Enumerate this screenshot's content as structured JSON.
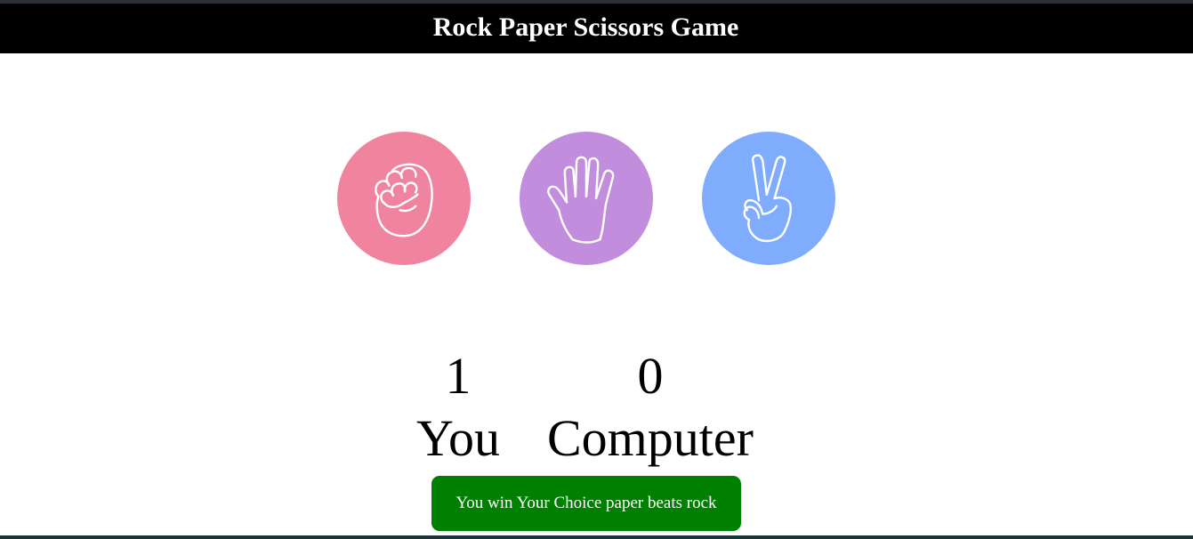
{
  "header": {
    "title": "Rock Paper Scissors Game"
  },
  "choices": [
    {
      "id": "rock",
      "icon": "fist-icon",
      "color": "#f0849f"
    },
    {
      "id": "paper",
      "icon": "open-hand-icon",
      "color": "#c28ddc"
    },
    {
      "id": "scissors",
      "icon": "peace-sign-icon",
      "color": "#80acfd"
    }
  ],
  "scoreboard": {
    "user_score": "1",
    "user_label": "You",
    "computer_score": "0",
    "computer_label": "Computer"
  },
  "message": {
    "text": "You win Your Choice paper beats rock",
    "color": "#008000"
  },
  "colors": {
    "header_bg": "#000000",
    "header_text": "#ffffff"
  }
}
